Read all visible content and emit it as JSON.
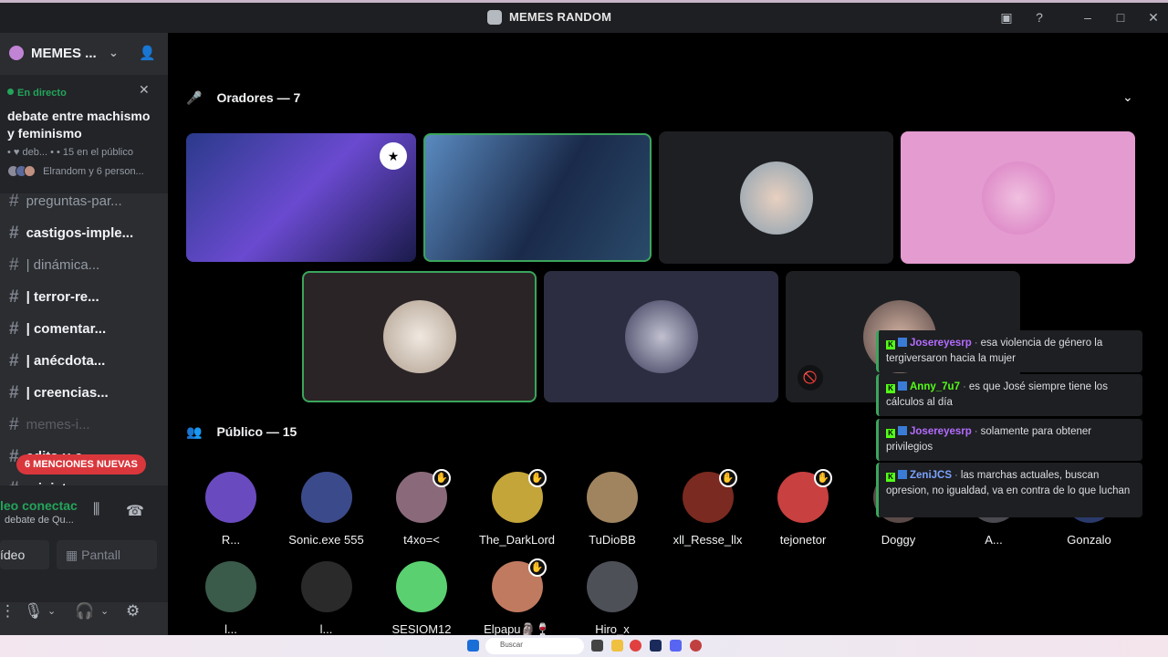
{
  "window": {
    "title": "MEMES RANDOM"
  },
  "sidebar": {
    "server_name": "MEMES ...",
    "stage": {
      "status": "En directo",
      "topic": "debate entre machismo y feminismo",
      "meta": "• ♥ deb... • • 15 en el público",
      "listeners": "Elrandom y 6 person..."
    },
    "channels": [
      {
        "name": "preguntas-par...",
        "emoji": "",
        "style": "dim"
      },
      {
        "name": "castigos-imple...",
        "emoji": "",
        "style": "bold"
      },
      {
        "name": "| dinámica...",
        "emoji": "😎",
        "style": "dim"
      },
      {
        "name": "| terror-re...",
        "emoji": "☠",
        "style": "bold"
      },
      {
        "name": "| comentar...",
        "emoji": "💬",
        "style": "bold"
      },
      {
        "name": "| anécdota...",
        "emoji": "😳",
        "style": "bold"
      },
      {
        "name": "| creencias...",
        "emoji": "🔮",
        "style": "bold"
      },
      {
        "name": "memes-i...",
        "emoji": "📷",
        "style": "muted"
      },
      {
        "name": "edits-y-c...",
        "emoji": "😁",
        "style": "bold"
      },
      {
        "name": "miniatura...",
        "emoji": "🖼",
        "style": "bold"
      }
    ],
    "mentions_badge": "6 MENCIONES NUEVAS",
    "voice": {
      "status": "leo conectac",
      "channel": "debate de Qu...",
      "video_label": "ídeo",
      "screen_label": "Pantall"
    }
  },
  "main": {
    "speakers_header": "Oradores — 7",
    "audience_header": "Público — 15",
    "audience": [
      {
        "name": "R...",
        "hand": false,
        "color": "#6a4bbf"
      },
      {
        "name": "Sonic.exe 555",
        "hand": false,
        "color": "#3b4a8a"
      },
      {
        "name": "t4xo=<",
        "hand": true,
        "color": "#8a6a7a"
      },
      {
        "name": "The_DarkLord",
        "hand": true,
        "color": "#c4a53a"
      },
      {
        "name": "TuDioBB",
        "hand": false,
        "color": "#a08460"
      },
      {
        "name": "xll_Resse_llx",
        "hand": true,
        "color": "#7a2a20"
      },
      {
        "name": "tejonetor",
        "hand": true,
        "color": "#c84040"
      },
      {
        "name": "Doggy",
        "hand": false,
        "color": "#5a4a48"
      },
      {
        "name": "A...",
        "hand": false,
        "color": "#4a4a50"
      },
      {
        "name": "Gonzalo",
        "hand": false,
        "color": "#2a3a6a"
      },
      {
        "name": "l...",
        "hand": false,
        "color": "#3a5a4a"
      },
      {
        "name": "l...",
        "hand": false,
        "color": "#2a2a2a"
      },
      {
        "name": "SESIOM12",
        "hand": false,
        "color": "#5ad070"
      },
      {
        "name": "Elpapu🗿🍷",
        "hand": true,
        "color": "#c07a60"
      },
      {
        "name": "Hiro_x",
        "hand": false,
        "color": "#4e5058"
      }
    ]
  },
  "chat_overlay": [
    {
      "user": "Josereyesrp",
      "user_color": "#b46cff",
      "text": "esa violencia de género la tergiversaron hacia la mujer"
    },
    {
      "user": "Anny_7u7",
      "user_color": "#53fc18",
      "text": "es que José siempre tiene los cálculos al día"
    },
    {
      "user": "Josereyesrp",
      "user_color": "#b46cff",
      "text": "solamente para obtener privilegios"
    },
    {
      "user": "ZeniJCS",
      "user_color": "#7aa2ff",
      "text": "las marchas actuales, buscan opresion, no igualdad, va en contra de lo que luchan"
    }
  ],
  "taskbar": {
    "search_placeholder": "Buscar"
  }
}
